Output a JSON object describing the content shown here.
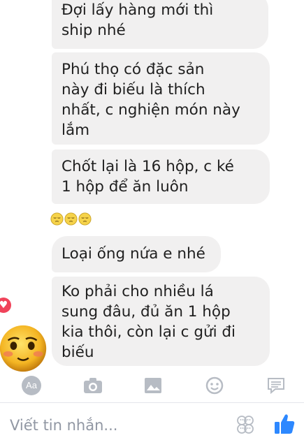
{
  "messages": [
    {
      "text": "Đợi lấy hàng mới thì\nship nhé"
    },
    {
      "text": "Phú thọ có đặc sản\nnày đi biếu là thích\nnhất, c nghiện món này\nlắm"
    },
    {
      "text": "Chốt lại là 16 hộp, c ké\n1 hộp để ăn luôn"
    },
    {
      "text": "Loại ống nứa e nhé"
    },
    {
      "text": "Ko phải cho nhiều lá\nsung đâu, đủ ăn 1 hộp\nkia thôi, còn lại c gửi đi\nbiếu"
    }
  ],
  "reaction_emojis": [
    "pensive-face",
    "pensive-face",
    "pensive-face"
  ],
  "toolbar": {
    "aa_label": "Aa",
    "icons": [
      "camera-icon",
      "image-icon",
      "smiley-icon",
      "chat-bubble-icon"
    ]
  },
  "composer": {
    "placeholder": "Viết tin nhắn..."
  },
  "colors": {
    "bubble_bg": "#f1f0f0",
    "accent_blue": "#2d88ff",
    "icon_gray": "#b7bcc4",
    "heart_red": "#f0435a"
  }
}
